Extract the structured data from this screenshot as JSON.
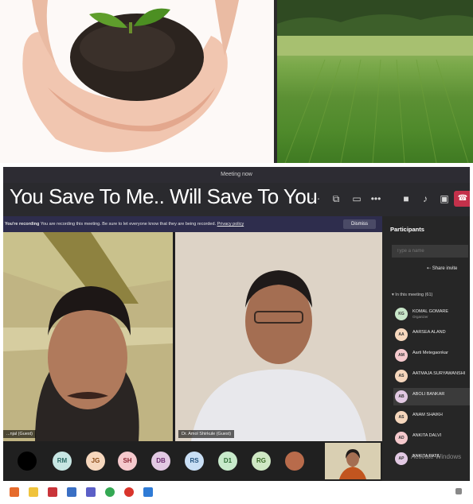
{
  "caption": "You Save To Me.. Will Save To You",
  "window": {
    "title": "Meeting now"
  },
  "recording_bar": {
    "lead": "You're recording",
    "message": "You are recording this meeting. Be sure to let everyone know that they are being recorded.",
    "link": "Privacy policy",
    "dismiss_label": "Dismiss"
  },
  "videos": [
    {
      "name": "...njal (Guest)"
    },
    {
      "name": "Dr. Amol Shirkule (Guest)"
    }
  ],
  "avatars": [
    {
      "initials": "RM",
      "bg": "#c7e6e3",
      "fg": "#2c6b66"
    },
    {
      "initials": "JG",
      "bg": "#f6d7bd",
      "fg": "#8a4b17"
    },
    {
      "initials": "SH",
      "bg": "#f5c9cd",
      "fg": "#8a2431"
    },
    {
      "initials": "DB",
      "bg": "#e2c9e3",
      "fg": "#6b2b6e"
    },
    {
      "initials": "RS",
      "bg": "#c9dff5",
      "fg": "#23527e"
    },
    {
      "initials": "D1",
      "bg": "#c8eacb",
      "fg": "#2b6b32"
    },
    {
      "initials": "RG",
      "bg": "#cfe8c4",
      "fg": "#3a6b26"
    }
  ],
  "panel": {
    "title": "Participants",
    "search_placeholder": "Type a name",
    "share_invite": "Share invite",
    "section": "In this meeting (61)",
    "people": [
      {
        "initials": "KG",
        "name": "KOMAL GOMARE",
        "sub": "Organizer",
        "bg": "#c8e6c9"
      },
      {
        "initials": "AA",
        "name": "AARSEA ALAND",
        "sub": "",
        "bg": "#f6d7bd"
      },
      {
        "initials": "AM",
        "name": "Aarti Metegaonkar",
        "sub": "",
        "bg": "#f5c9cd"
      },
      {
        "initials": "AS",
        "name": "AATMAJA SURYAWANSHI",
        "sub": "",
        "bg": "#f6d7bd"
      },
      {
        "initials": "AB",
        "name": "ABOLI BANKAR",
        "sub": "",
        "bg": "#e2c9e3"
      },
      {
        "initials": "AS",
        "name": "ANAM SHAIKH",
        "sub": "",
        "bg": "#f6d7bd"
      },
      {
        "initials": "AD",
        "name": "ANKITA DALVI",
        "sub": "",
        "bg": "#f5c9cd"
      },
      {
        "initials": "AP",
        "name": "ANKITA PATIL",
        "sub": "",
        "bg": "#e2c9e3"
      }
    ],
    "watermark": "Activate Windows"
  },
  "colors": {
    "accent": "#6264a7",
    "leave": "#c4314b"
  }
}
